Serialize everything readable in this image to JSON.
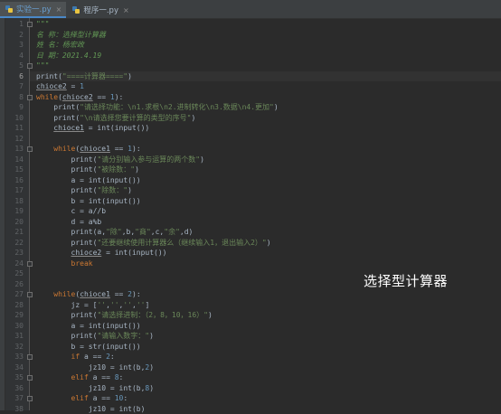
{
  "tabs": [
    {
      "label": "实验一.py",
      "active": true
    },
    {
      "label": "程序一.py",
      "active": false
    }
  ],
  "lines": [
    {
      "n": "1",
      "html": "<span class=\"cmt\">\"\"\"</span>"
    },
    {
      "n": "2",
      "html": "<span class=\"cmt\">名 称：选择型计算器</span>"
    },
    {
      "n": "3",
      "html": "<span class=\"cmt\">姓 名：杨宏政</span>"
    },
    {
      "n": "4",
      "html": "<span class=\"cmt\">日 期：2021.4.19</span>"
    },
    {
      "n": "5",
      "html": "<span class=\"cmt\">\"\"\"</span>"
    },
    {
      "n": "6",
      "html": "print(<span class=\"str\">\"====计算器====\"</span>)"
    },
    {
      "n": "7",
      "html": "<span class=\"und\">chioce2</span> = <span class=\"num\">1</span>"
    },
    {
      "n": "8",
      "html": "<span class=\"kw\">while</span>(<span class=\"und\">chioce2</span> == <span class=\"num\">1</span>):"
    },
    {
      "n": "9",
      "html": "    print(<span class=\"str\">\"请选择功能：\\n1.求根\\n2.进制转化\\n3.数据\\n4.更加\"</span>)"
    },
    {
      "n": "10",
      "html": "    print(<span class=\"str\">\"\\n请选择您要计算的类型的序号\"</span>)"
    },
    {
      "n": "11",
      "html": "    <span class=\"und\">chioce1</span> = int(input())"
    },
    {
      "n": "12",
      "html": ""
    },
    {
      "n": "13",
      "html": "    <span class=\"kw\">while</span>(<span class=\"und\">chioce1</span> == <span class=\"num\">1</span>):"
    },
    {
      "n": "14",
      "html": "        print(<span class=\"str\">\"请分别输入参与运算的两个数\"</span>)"
    },
    {
      "n": "15",
      "html": "        print(<span class=\"str\">\"被除数：\"</span>)"
    },
    {
      "n": "16",
      "html": "        a = int(input())"
    },
    {
      "n": "17",
      "html": "        print(<span class=\"str\">\"除数：\"</span>)"
    },
    {
      "n": "18",
      "html": "        b = int(input())"
    },
    {
      "n": "19",
      "html": "        c = a//b"
    },
    {
      "n": "20",
      "html": "        d = a%b"
    },
    {
      "n": "21",
      "html": "        print(a,<span class=\"str\">\"除\"</span>,b,<span class=\"str\">\"商\"</span>,c,<span class=\"str\">\"余\"</span>,d)"
    },
    {
      "n": "22",
      "html": "        print(<span class=\"str\">\"还要继续使用计算器么（继续输入1，退出输入2）\"</span>)"
    },
    {
      "n": "23",
      "html": "        <span class=\"und\">chioce2</span> = int(input())"
    },
    {
      "n": "24",
      "html": "        <span class=\"kw\">break</span>"
    },
    {
      "n": "25",
      "html": ""
    },
    {
      "n": "26",
      "html": ""
    },
    {
      "n": "27",
      "html": "    <span class=\"kw\">while</span>(<span class=\"und\">chioce1</span> == <span class=\"num\">2</span>):"
    },
    {
      "n": "28",
      "html": "        jz = [<span class=\"str\">''</span>,<span class=\"str\">''</span>,<span class=\"str\">''</span>,<span class=\"str\">''</span>]"
    },
    {
      "n": "29",
      "html": "        print(<span class=\"str\">\"请选择进制：（2，8，10，16）\"</span>)"
    },
    {
      "n": "30",
      "html": "        a = int(input())"
    },
    {
      "n": "31",
      "html": "        print(<span class=\"str\">\"请输入数字：\"</span>)"
    },
    {
      "n": "32",
      "html": "        b = str(input())"
    },
    {
      "n": "33",
      "html": "        <span class=\"kw\">if</span> a == <span class=\"num\">2</span>:"
    },
    {
      "n": "34",
      "html": "            jz10 = int(b,<span class=\"num\">2</span>)"
    },
    {
      "n": "35",
      "html": "        <span class=\"kw\">elif</span> a == <span class=\"num\">8</span>:"
    },
    {
      "n": "36",
      "html": "            jz10 = int(b,<span class=\"num\">8</span>)"
    },
    {
      "n": "37",
      "html": "        <span class=\"kw\">elif</span> a == <span class=\"num\">10</span>:"
    },
    {
      "n": "38",
      "html": "            jz10 = int(b)"
    }
  ],
  "current_line": "6",
  "overlay_text": "选择型计算器"
}
